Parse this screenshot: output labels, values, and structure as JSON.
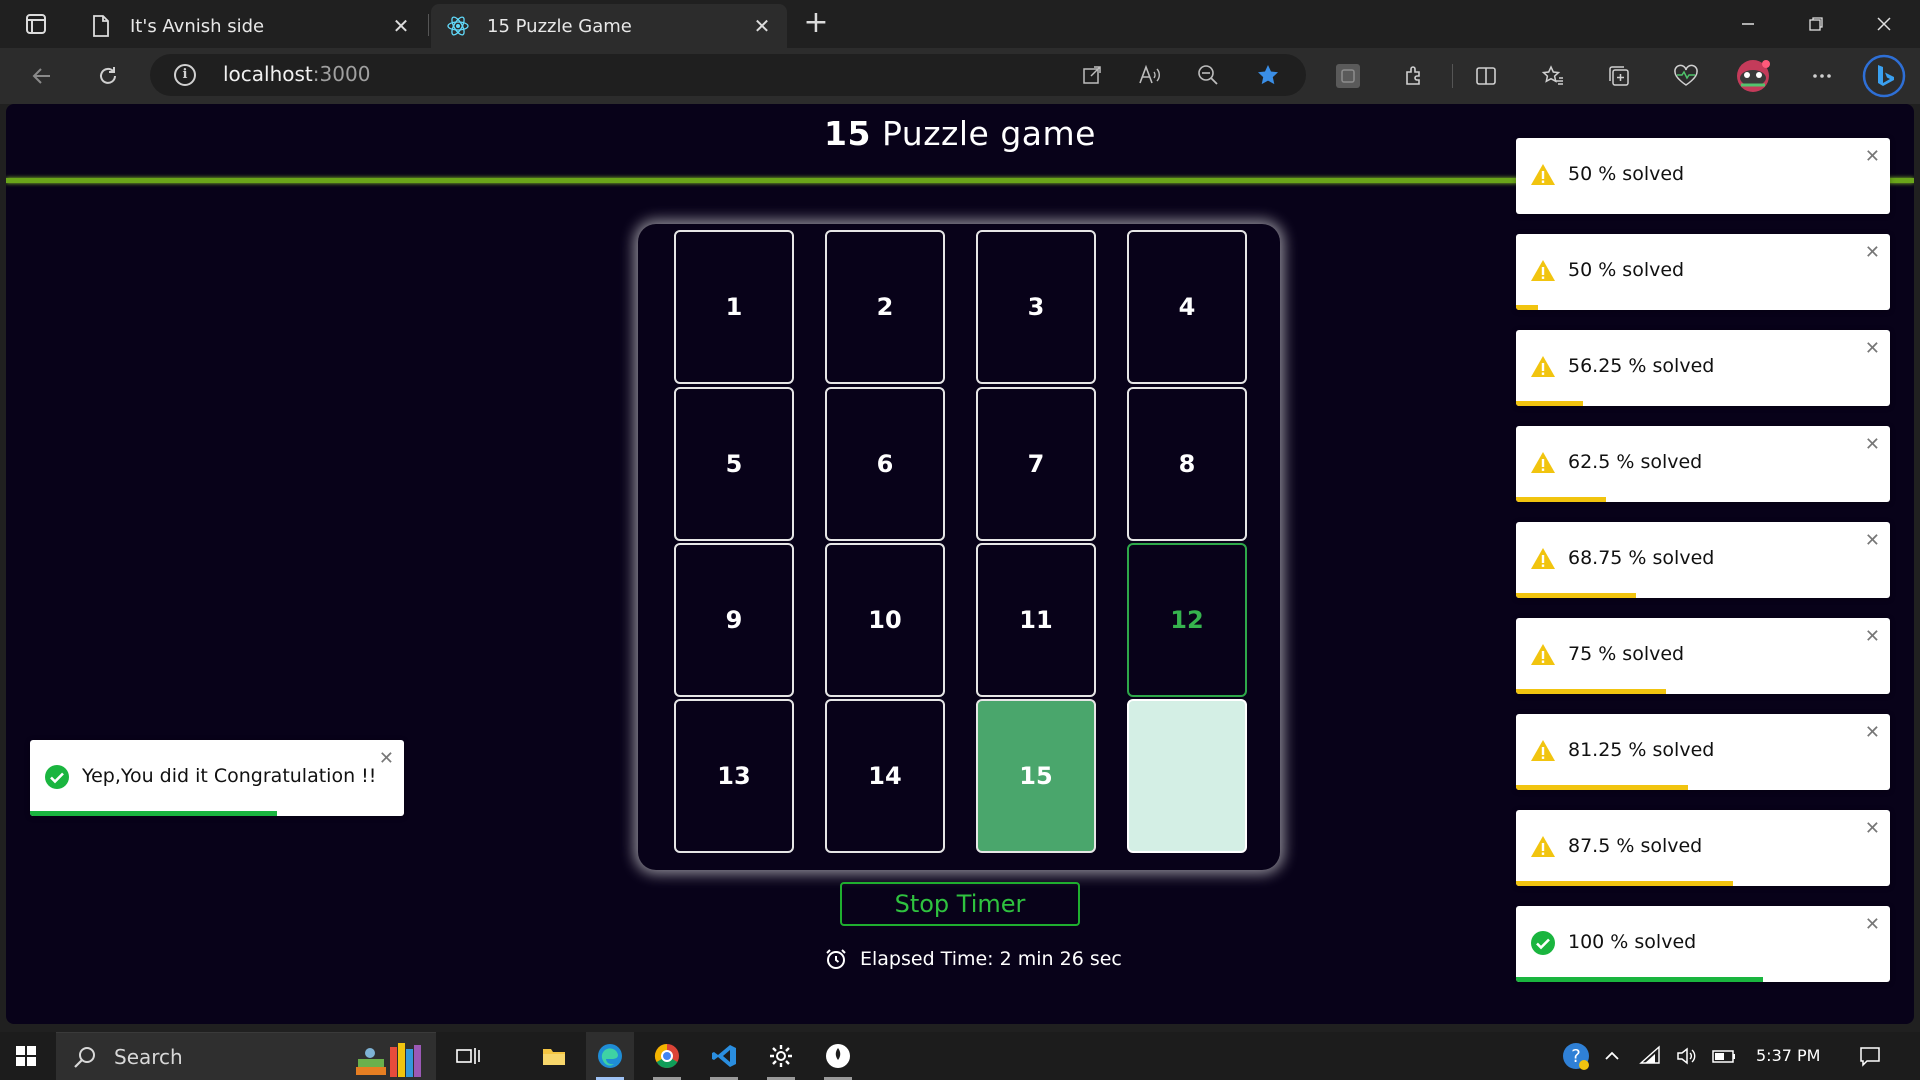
{
  "browser": {
    "tabs": [
      {
        "label": "It's Avnish side",
        "active": false
      },
      {
        "label": "15 Puzzle Game",
        "active": true
      }
    ],
    "address": {
      "host": "localhost",
      "port": ":3000"
    }
  },
  "page": {
    "title_number": "15",
    "title_text": " Puzzle game",
    "tiles": [
      "1",
      "2",
      "3",
      "4",
      "5",
      "6",
      "7",
      "8",
      "9",
      "10",
      "11",
      "12",
      "13",
      "14",
      "15",
      ""
    ],
    "tile_states": [
      "normal",
      "normal",
      "normal",
      "normal",
      "normal",
      "normal",
      "normal",
      "normal",
      "normal",
      "normal",
      "normal",
      "correct",
      "normal",
      "normal",
      "filled",
      "empty"
    ],
    "stop_timer_label": "Stop Timer",
    "elapsed_text": "Elapsed Time: 2 min 26 sec"
  },
  "toasts": [
    {
      "message": "50 % solved",
      "type": "warning",
      "progress": 0.0
    },
    {
      "message": "50 % solved",
      "type": "warning",
      "progress": 0.06
    },
    {
      "message": "56.25 % solved",
      "type": "warning",
      "progress": 0.18
    },
    {
      "message": "62.5 % solved",
      "type": "warning",
      "progress": 0.24
    },
    {
      "message": "68.75 % solved",
      "type": "warning",
      "progress": 0.32
    },
    {
      "message": "75 % solved",
      "type": "warning",
      "progress": 0.4
    },
    {
      "message": "81.25 % solved",
      "type": "warning",
      "progress": 0.46
    },
    {
      "message": "87.5 % solved",
      "type": "warning",
      "progress": 0.58
    },
    {
      "message": "100 % solved",
      "type": "success",
      "progress": 0.66
    }
  ],
  "congrats_toast": {
    "message": "Yep,You did it Congratulation !!",
    "type": "success",
    "progress": 0.66
  },
  "taskbar": {
    "search_label": "Search",
    "time": "5:37 PM"
  },
  "colors": {
    "accent_green": "#6aa51a",
    "warning": "#f1c40f",
    "success": "#1ab53f",
    "page_bg": "#080219"
  }
}
